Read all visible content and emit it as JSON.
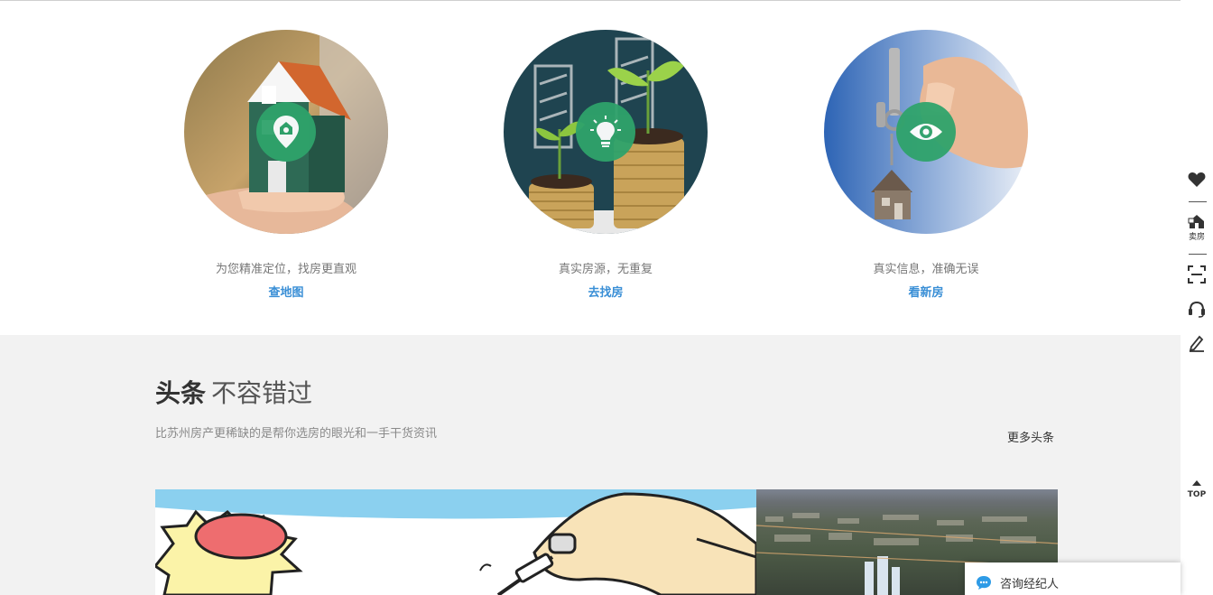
{
  "features": [
    {
      "desc": "为您精准定位，找房更直观",
      "link": "查地图",
      "icon": "location-pin-icon"
    },
    {
      "desc": "真实房源，无重复",
      "link": "去找房",
      "icon": "lightbulb-icon"
    },
    {
      "desc": "真实信息，准确无误",
      "link": "看新房",
      "icon": "eye-icon"
    }
  ],
  "news": {
    "title_bold": "头条",
    "title_rest": "不容错过",
    "subtitle": "比苏州房产更稀缺的是帮你选房的眼光和一手干货资讯",
    "more": "更多头条"
  },
  "sidebar": {
    "sell_label": "卖房",
    "top_label": "TOP",
    "icons": [
      "heart-icon",
      "sell-house-icon",
      "scan-icon",
      "headset-icon",
      "edit-icon",
      "back-to-top-icon"
    ]
  },
  "consult": {
    "label": "咨询经纪人"
  },
  "colors": {
    "accent_green": "#2fa36b",
    "link_blue": "#3a8fd6",
    "news_bg": "#f2f2f2"
  }
}
